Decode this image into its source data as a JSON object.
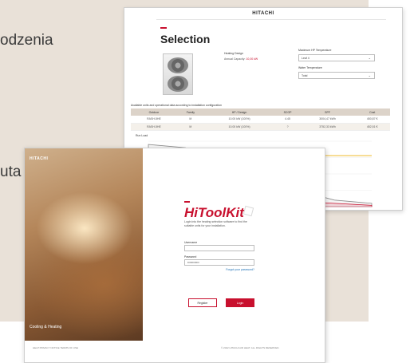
{
  "slide": {
    "text_top": "odzenia",
    "text_mid": "uta"
  },
  "selection_screen": {
    "logo": "HITACHI",
    "title": "Selection",
    "heating_design_label": "Heating Design",
    "annual_capacity_label": "Annual Capacity:",
    "annual_capacity_value": "10,00 kW",
    "max_temp_label": "Maximum HP Temperature",
    "max_temp_value": "Leaf 4",
    "water_temp_label": "Water Temperature",
    "water_temp_value": "Total",
    "table_title": "Available units and operational data according to installation configuration",
    "table_headers": [
      "Outdoor",
      "Family",
      "HP / Design",
      "SCOP",
      "SPF",
      "Cost"
    ],
    "table_rows": [
      [
        "RASH-5HE",
        "M",
        "10.00 kW (100%)",
        "4.45",
        "3004,47 kWh",
        "450,87 €"
      ],
      [
        "RASH-5HE",
        "M",
        "10.00 kW (100%)",
        "?",
        "3752,33 kWh",
        "452,51 €"
      ]
    ],
    "chart_label": "Run Load"
  },
  "login_screen": {
    "left_logo": "HITACHI",
    "left_caption": "Cooling & Heating",
    "brand": "HiToolKit",
    "intro": "Login into the heating selection software to find the suitable units for your installation.",
    "username_label": "Username",
    "username_value": "",
    "password_label": "Password",
    "password_value": "••••••••••••",
    "forgot_link": "Forgot your password?",
    "register_button": "Register",
    "login_button": "Login",
    "footer_links": "HELP   PRIVACY NOTICE   TERMS OF USE",
    "footer_copy": "© 2022 HITACHI AIR HEAT. ALL RIGHTS RESERVED."
  },
  "colors": {
    "brand_red": "#c8102e",
    "panel_beige": "#e9e1d8",
    "table_header": "#dcd3c9"
  },
  "chart_data": {
    "type": "area",
    "title": "Run Load",
    "series": [
      {
        "values": [
          0.95,
          0.9,
          0.65,
          0.45,
          0.25,
          0.1,
          0.05
        ]
      },
      {
        "values": [
          0.25,
          0.22,
          0.18,
          0.12,
          0.08,
          0.05,
          0.02
        ]
      }
    ],
    "threshold": 0.78,
    "grid": true
  }
}
